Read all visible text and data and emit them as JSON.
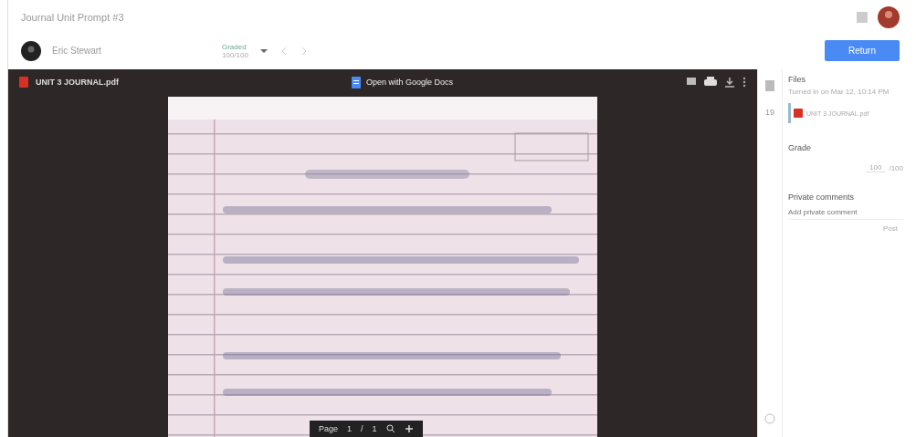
{
  "header": {
    "title": "Journal Unit Prompt #3",
    "student": {
      "name": "Eric Stewart"
    },
    "status": {
      "label": "Graded",
      "points": "100/100"
    },
    "return_button": "Return"
  },
  "viewer": {
    "file_name": "UNIT 3 JOURNAL.pdf",
    "open_with": "Open with Google Docs",
    "pager": {
      "label": "Page",
      "current": "1",
      "separator": "/",
      "total": "1"
    }
  },
  "side_panel": {
    "rail_count": "19",
    "files": {
      "heading": "Files",
      "note": "Turned in on Mar 12, 10:14 PM",
      "attachment": "UNIT 3 JOURNAL.pdf"
    },
    "grade": {
      "heading": "Grade",
      "value": "100",
      "max": "/100"
    },
    "comments": {
      "heading": "Private comments",
      "placeholder": "Add private comment",
      "post": "Post"
    }
  }
}
